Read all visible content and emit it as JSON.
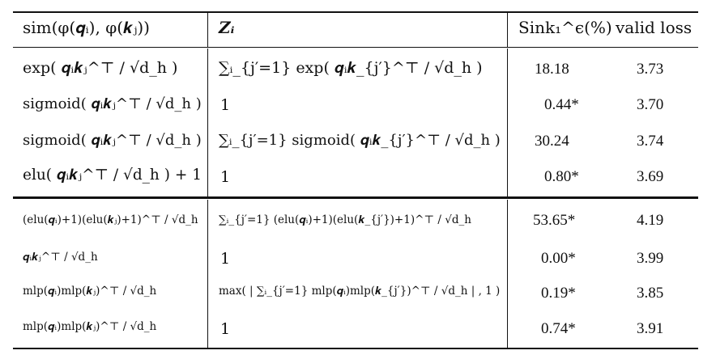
{
  "header": {
    "col1": "sim(φ(𝒒ᵢ), φ(𝒌ⱼ))",
    "col2": "𝒁ᵢ",
    "col3": "Sink₁^ϵ(%)",
    "col4": "valid loss"
  },
  "groups": [
    {
      "rows": [
        {
          "sim": "exp( 𝒒ᵢ𝒌ⱼ^⊤ / √d_h )",
          "z": "∑ᵢ_{j′=1} exp( 𝒒ᵢ𝒌_{j′}^⊤ / √d_h )",
          "sink": "18.18",
          "loss": "3.73"
        },
        {
          "sim": "sigmoid( 𝒒ᵢ𝒌ⱼ^⊤ / √d_h )",
          "z": "1",
          "sink": "0.44*",
          "loss": "3.70"
        },
        {
          "sim": "sigmoid( 𝒒ᵢ𝒌ⱼ^⊤ / √d_h )",
          "z": "∑ᵢ_{j′=1} sigmoid( 𝒒ᵢ𝒌_{j′}^⊤ / √d_h )",
          "sink": "30.24",
          "loss": "3.74"
        },
        {
          "sim": "elu( 𝒒ᵢ𝒌ⱼ^⊤ / √d_h ) + 1",
          "z": "1",
          "sink": "0.80*",
          "loss": "3.69"
        }
      ]
    },
    {
      "rows": [
        {
          "sim": "(elu(𝒒ᵢ)+1)(elu(𝒌ⱼ)+1)^⊤ / √d_h",
          "z": "∑ᵢ_{j′=1} (elu(𝒒ᵢ)+1)(elu(𝒌_{j′})+1)^⊤ / √d_h",
          "sink": "53.65*",
          "loss": "4.19"
        },
        {
          "sim": "𝒒ᵢ𝒌ⱼ^⊤ / √d_h",
          "z": "1",
          "sink": "0.00*",
          "loss": "3.99"
        },
        {
          "sim": "mlp(𝒒ᵢ)mlp(𝒌ⱼ)^⊤ / √d_h",
          "z": "max( | ∑ᵢ_{j′=1} mlp(𝒒ᵢ)mlp(𝒌_{j′})^⊤ / √d_h | , 1 )",
          "sink": "0.19*",
          "loss": "3.85"
        },
        {
          "sim": "mlp(𝒒ᵢ)mlp(𝒌ⱼ)^⊤ / √d_h",
          "z": "1",
          "sink": "0.74*",
          "loss": "3.91"
        }
      ]
    }
  ]
}
